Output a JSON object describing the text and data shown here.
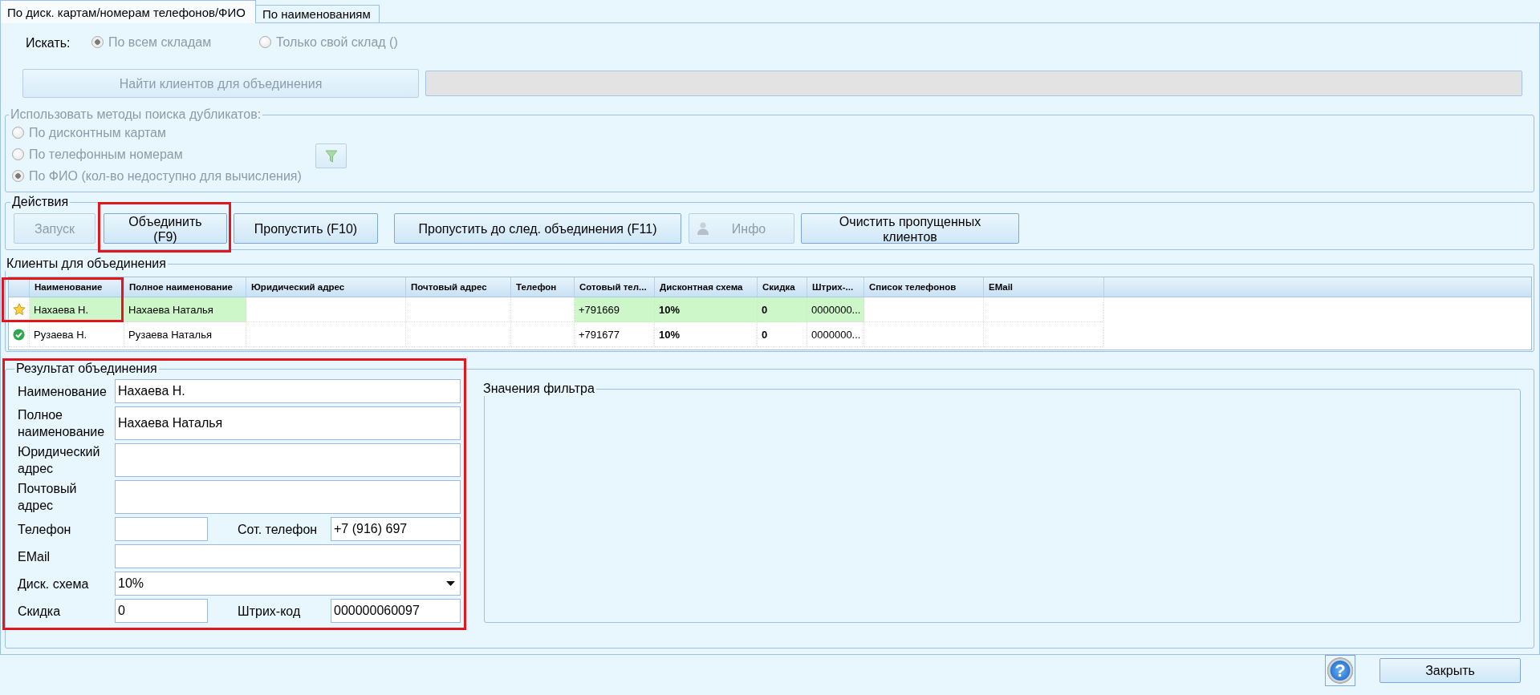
{
  "tabs": [
    {
      "label": "По диск. картам/номерам телефонов/ФИО",
      "selected": true
    },
    {
      "label": "По наименованиям",
      "selected": false
    }
  ],
  "search": {
    "label": "Искать:",
    "options": [
      {
        "label": "По всем складам",
        "selected": true,
        "disabled": true
      },
      {
        "label": "Только свой склад ()",
        "selected": false,
        "disabled": true
      }
    ]
  },
  "find": {
    "button": {
      "label": "Найти клиентов для объединения",
      "disabled": true
    },
    "progress": {
      "level": 0
    }
  },
  "methods": {
    "title": "Использовать методы поиска дубликатов:",
    "disabled": true,
    "options": [
      {
        "label": "По дисконтным картам",
        "selected": false,
        "disabled": true
      },
      {
        "label": "По телефонным номерам",
        "selected": false,
        "disabled": true
      },
      {
        "label": "По ФИО (кол-во недоступно для вычисления)",
        "selected": true,
        "disabled": true
      }
    ],
    "filter_button": {
      "disabled": true
    }
  },
  "actions": {
    "title": "Действия",
    "buttons": [
      {
        "label": "Запуск",
        "kind": "text",
        "disabled": true,
        "highlighted": false
      },
      {
        "label": "Объединить\n(F9)",
        "kind": "text",
        "disabled": false,
        "highlighted": true
      },
      {
        "label": "Пропустить (F10)",
        "kind": "text",
        "disabled": false,
        "highlighted": false
      },
      {
        "label": "Пропустить до след. объединения (F11)",
        "kind": "text",
        "disabled": false,
        "highlighted": false
      },
      {
        "label": "Инфо",
        "kind": "person",
        "disabled": true,
        "highlighted": false
      },
      {
        "label": "Очистить пропущенных\nклиентов",
        "kind": "text",
        "disabled": false,
        "highlighted": false
      }
    ]
  },
  "clients": {
    "title": "Клиенты для объединения",
    "columns": [
      {
        "label": "Наименование"
      },
      {
        "label": "Полное наименование"
      },
      {
        "label": "Юридический адрес"
      },
      {
        "label": "Почтовый адрес"
      },
      {
        "label": "Телефон"
      },
      {
        "label": "Сотовый тел..."
      },
      {
        "label": "Дисконтная схема"
      },
      {
        "label": "Скидка"
      },
      {
        "label": "Штрих-..."
      },
      {
        "label": "Список телефонов"
      },
      {
        "label": "EMail"
      }
    ],
    "rows": [
      {
        "kind": "main",
        "highlighted": true,
        "cells": [
          {
            "text": "Нахаева Н.",
            "selected": true,
            "bold": false
          },
          {
            "text": "Нахаева Наталья",
            "selected": true,
            "bold": false
          },
          {
            "selected": false
          },
          {
            "selected": false
          },
          {
            "selected": false
          },
          {
            "text": "+791669",
            "selected": true,
            "bold": false
          },
          {
            "text": "10%",
            "selected": true,
            "bold": true
          },
          {
            "text": "0",
            "selected": true,
            "bold": true
          },
          {
            "text": "0000000...",
            "selected": true,
            "bold": false
          },
          {
            "selected": false
          },
          {
            "selected": false
          }
        ]
      },
      {
        "kind": "merged",
        "highlighted": false,
        "cells": [
          {
            "text": "Рузаева Н.",
            "selected": false,
            "bold": false
          },
          {
            "text": "Рузаева Наталья",
            "selected": false,
            "bold": false
          },
          {
            "selected": false
          },
          {
            "selected": false
          },
          {
            "selected": false
          },
          {
            "text": "+791677",
            "selected": false,
            "bold": false
          },
          {
            "text": "10%",
            "selected": false,
            "bold": true
          },
          {
            "text": "0",
            "selected": false,
            "bold": true
          },
          {
            "text": "0000000...",
            "selected": false,
            "bold": false
          },
          {
            "selected": false
          },
          {
            "selected": false
          }
        ]
      }
    ]
  },
  "result": {
    "title": "Результат объединения",
    "highlighted": true,
    "rows": [
      {
        "fields": [
          {
            "label": "Наименование",
            "value": "Нахаева Н.",
            "kind": "text"
          }
        ]
      },
      {
        "fields": [
          {
            "label": "Полное наименование",
            "value": "Нахаева Наталья",
            "kind": "text"
          }
        ]
      },
      {
        "fields": [
          {
            "label": "Юридический адрес",
            "kind": "text"
          }
        ]
      },
      {
        "fields": [
          {
            "label": "Почтовый адрес",
            "kind": "text"
          }
        ]
      },
      {
        "fields": [
          {
            "label": "Телефон",
            "kind": "text"
          },
          {
            "label": "Сот. телефон",
            "value": "+7 (916) 697",
            "kind": "text"
          }
        ]
      },
      {
        "fields": [
          {
            "label": "EMail",
            "kind": "text"
          }
        ]
      },
      {
        "fields": [
          {
            "label": "Диск. схема",
            "value": "10%",
            "kind": "dropdown"
          }
        ]
      },
      {
        "fields": [
          {
            "label": "Скидка",
            "value": "0",
            "kind": "text"
          },
          {
            "label": "Штрих-код",
            "value": "000000060097",
            "kind": "text"
          }
        ]
      }
    ],
    "filter_values": {
      "title": "Значения фильтра"
    }
  },
  "footer": {
    "help_button": {
      "label": "?"
    },
    "close_button": {
      "label": "Закрыть"
    }
  }
}
